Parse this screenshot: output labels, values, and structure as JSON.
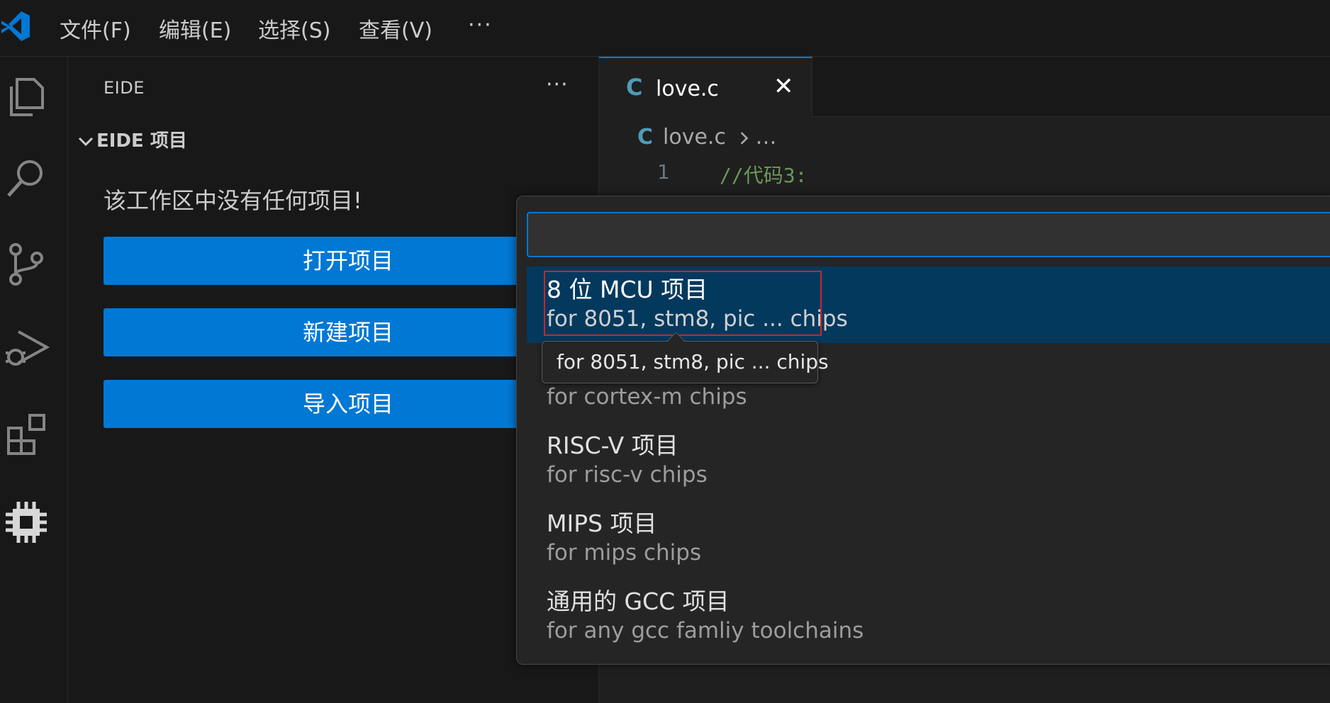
{
  "menubar": {
    "items": [
      "文件(F)",
      "编辑(E)",
      "选择(S)",
      "查看(V)"
    ],
    "more": "···"
  },
  "activitybar": {
    "icons": [
      "explorer-icon",
      "search-icon",
      "source-control-icon",
      "run-debug-icon",
      "extensions-icon",
      "eide-chip-icon"
    ]
  },
  "sidebar": {
    "title": "EIDE",
    "more": "···",
    "section": "EIDE 项目",
    "empty_message": "该工作区中没有任何项目!",
    "buttons": [
      "打开项目",
      "新建项目",
      "导入项目"
    ]
  },
  "editor": {
    "tab": {
      "icon_letter": "C",
      "label": "love.c",
      "close": "✕"
    },
    "breadcrumb": {
      "icon_letter": "C",
      "file": "love.c",
      "rest": "…"
    },
    "lines": [
      {
        "number": "1",
        "text": "//代码3:"
      }
    ]
  },
  "quickpick": {
    "input_value": "",
    "items": [
      {
        "label": "8 位 MCU 项目",
        "description": "for 8051, stm8, pic ... chips"
      },
      {
        "label": "",
        "description": "for cortex-m chips"
      },
      {
        "label": "RISC-V 项目",
        "description": "for risc-v chips"
      },
      {
        "label": "MIPS 项目",
        "description": "for mips chips"
      },
      {
        "label": "通用的 GCC 项目",
        "description": "for any gcc famliy toolchains"
      }
    ],
    "tooltip": "for 8051, stm8, pic ... chips"
  },
  "colors": {
    "accent": "#0078d4",
    "selected": "#04395e",
    "comment": "#6a9955",
    "c_file_icon": "#519aba",
    "highlight_box": "#c62828"
  }
}
